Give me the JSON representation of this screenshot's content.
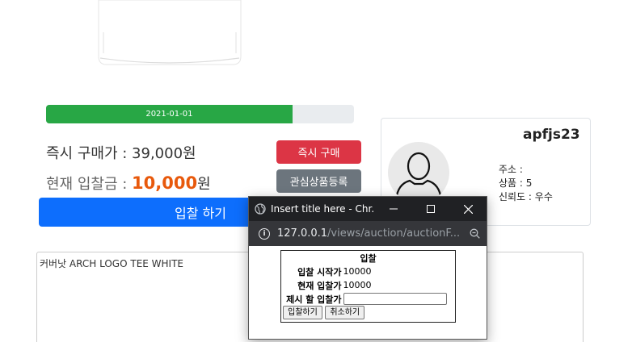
{
  "progress": {
    "label": "2021-01-01",
    "fraction": 0.8,
    "color": "#28a745"
  },
  "prices": {
    "buy_now_label": "즉시 구매가 :",
    "buy_now_value": "39,000원",
    "current_bid_label": "현재 입찰금 :",
    "current_bid_value": "10,000",
    "currency": "원"
  },
  "buttons": {
    "buy_now": "즉시 구매",
    "wishlist": "관심상품등록",
    "bid": "입찰 하기"
  },
  "seller": {
    "name": "apfjs23",
    "address_label": "주소 :",
    "products": "상품 : 5",
    "rating": "신뢰도 : 우수"
  },
  "description": "커버낫 ARCH LOGO TEE WHITE",
  "popup": {
    "title": "Insert title here - Chr...",
    "url_host": "127.0.0.1",
    "url_path": "/views/auction/auctionF...",
    "form": {
      "heading": "입찰",
      "start_label": "입찰 시작가",
      "start_value": "10000",
      "current_label": "현재 입찰가",
      "current_value": "10000",
      "offer_label": "제시 할 입찰가",
      "offer_value": "",
      "submit": "입찰하기",
      "cancel": "취소하기"
    }
  },
  "colors": {
    "danger": "#dc3545",
    "secondary": "#6c757d",
    "primary": "#0d6efd",
    "bid_amount": "#e8590c"
  }
}
